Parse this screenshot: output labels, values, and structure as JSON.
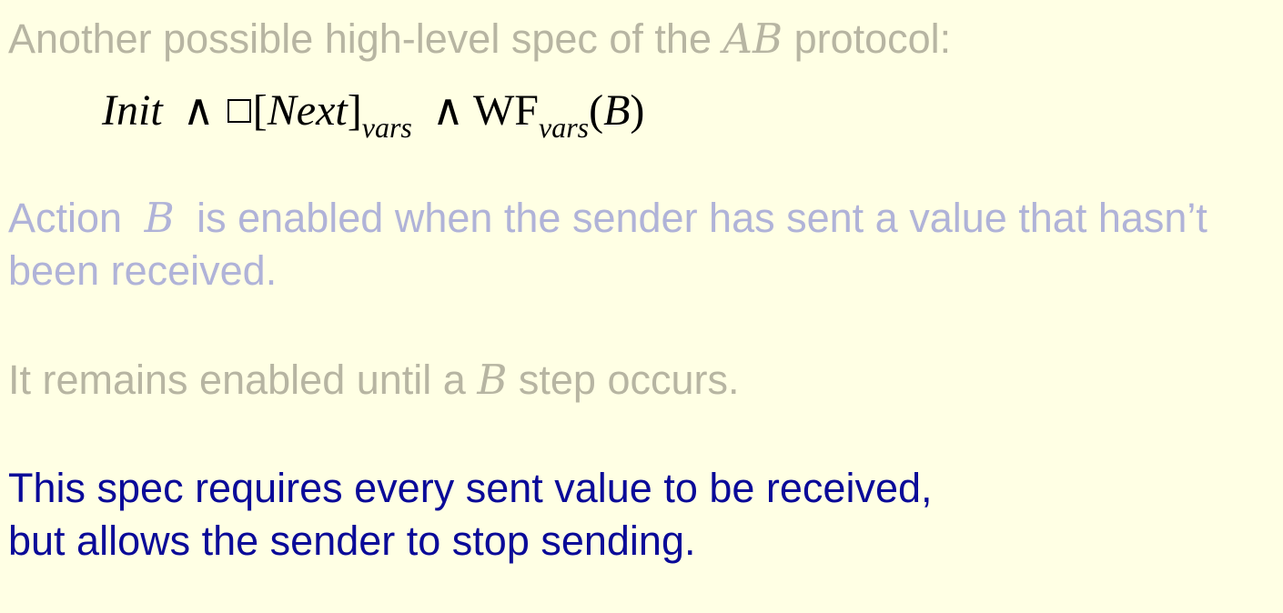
{
  "slide": {
    "heading": {
      "before": "Another possible high-level spec of the ",
      "math": "AB",
      "after": " protocol:"
    },
    "formula": {
      "init": "Init",
      "and1": "∧",
      "box": "□",
      "open": "[",
      "next": "Next",
      "close": "]",
      "sub1": "vars",
      "and2": "∧",
      "wf": "WF",
      "sub2": "vars",
      "arg_open": "(",
      "arg": "B",
      "arg_close": ")"
    },
    "para1": {
      "line1_before": "Action ",
      "line1_math": "B",
      "line1_after": " is enabled when the sender has sent a value that hasn’t",
      "line2": "been received."
    },
    "para2": {
      "before": "It remains enabled until a ",
      "math": "B",
      "after": " step occurs."
    },
    "para3": {
      "line1": "This spec requires every sent value to be received,",
      "line2": "but allows the sender to stop sending."
    }
  }
}
